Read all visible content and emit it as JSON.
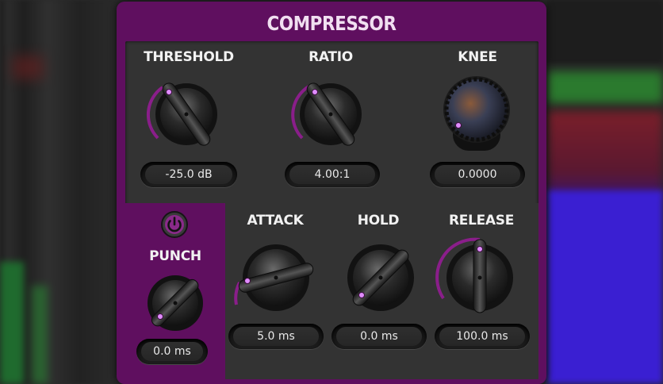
{
  "plugin": {
    "title": "COMPRESSOR"
  },
  "controls": {
    "threshold": {
      "label": "THRESHOLD",
      "value": "-25.0 dB"
    },
    "ratio": {
      "label": "RATIO",
      "value": "4.00:1"
    },
    "knee": {
      "label": "KNEE",
      "value": "0.0000"
    },
    "punch": {
      "label": "PUNCH",
      "value": "0.0 ms"
    },
    "attack": {
      "label": "ATTACK",
      "value": "5.0 ms"
    },
    "hold": {
      "label": "HOLD",
      "value": "0.0 ms"
    },
    "release": {
      "label": "RELEASE",
      "value": "100.0 ms"
    }
  },
  "colors": {
    "accent": "#7a1a7a",
    "accent_bright": "#b532b5",
    "indicator": "#e080ff"
  },
  "icons": {
    "punch_toggle": "power-icon"
  }
}
